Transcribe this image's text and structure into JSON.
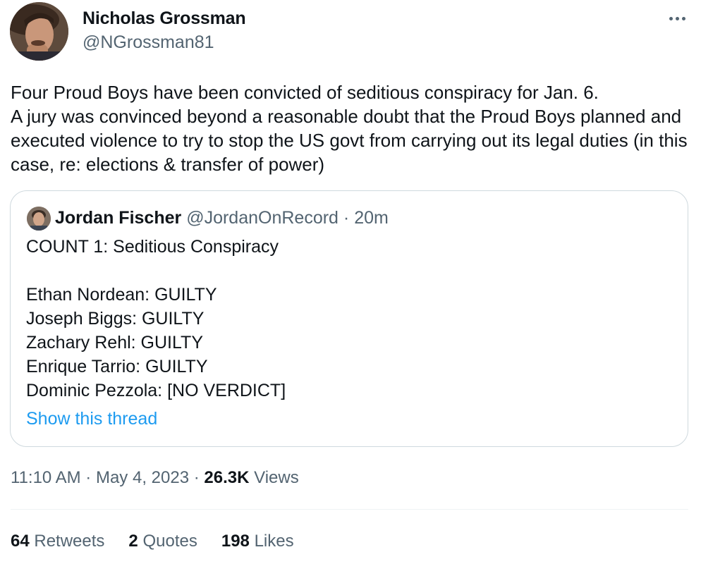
{
  "author": {
    "name": "Nicholas Grossman",
    "handle": "@NGrossman81"
  },
  "tweet": {
    "text": "Four Proud Boys have been convicted of seditious conspiracy for Jan. 6.\nA jury was convinced beyond a reasonable doubt that the Proud Boys planned and executed violence to try to stop the US govt from carrying out its legal duties (in this case, re: elections & transfer of power)"
  },
  "quote": {
    "name": "Jordan Fischer",
    "handle": "@JordanOnRecord",
    "separator": "·",
    "time": "20m",
    "lines": [
      "COUNT 1: Seditious Conspiracy",
      "",
      "Ethan Nordean: GUILTY",
      "Joseph Biggs: GUILTY",
      "Zachary Rehl: GUILTY",
      "Enrique Tarrio: GUILTY",
      "Dominic Pezzola: [NO VERDICT]"
    ],
    "show_thread": "Show this thread"
  },
  "meta": {
    "time": "11:10 AM",
    "separator": "·",
    "date": "May 4, 2023",
    "views_count": "26.3K",
    "views_label": "Views"
  },
  "stats": {
    "retweets_count": "64",
    "retweets_label": "Retweets",
    "quotes_count": "2",
    "quotes_label": "Quotes",
    "likes_count": "198",
    "likes_label": "Likes"
  },
  "colors": {
    "link": "#1d9bf0",
    "secondary_text": "#536471",
    "primary_text": "#0f1419",
    "border": "#cfd9de"
  },
  "icons": {
    "more": "more-horizontal-icon"
  }
}
